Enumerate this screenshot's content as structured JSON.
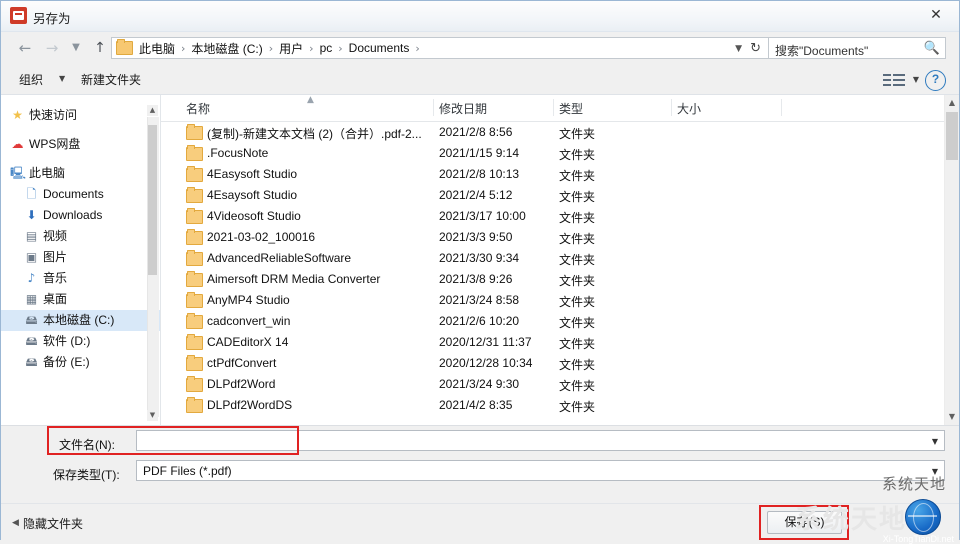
{
  "window": {
    "title": "另存为",
    "close_label": "✕"
  },
  "nav": {
    "back_icon": "←",
    "forward_icon": "→",
    "history_icon": "▼",
    "up_icon": "↑",
    "breadcrumb": [
      "此电脑",
      "本地磁盘 (C:)",
      "用户",
      "pc",
      "Documents"
    ],
    "breadcrumb_sep": "›",
    "dropdown_caret": "▼",
    "refresh_icon": "↻",
    "search_value": "搜索\"Documents\"",
    "search_icon": "🔍"
  },
  "toolbar": {
    "organize": "组织",
    "organize_caret": "▼",
    "new_folder": "新建文件夹",
    "view_caret": "▼",
    "help": "?"
  },
  "sidebar": {
    "items": [
      {
        "label": "快速访问",
        "icon": "★",
        "color": "#f2c14a",
        "selected": false
      },
      {
        "label": "WPS网盘",
        "icon": "☁",
        "color": "#e03a3a",
        "selected": false
      },
      {
        "label": "此电脑",
        "icon": "🖳",
        "color": "#4b88c7",
        "selected": false
      },
      {
        "label": "Documents",
        "icon": "🗋",
        "color": "#4b88c7",
        "selected": false
      },
      {
        "label": "Downloads",
        "icon": "⬇",
        "color": "#2f6fbd",
        "selected": false
      },
      {
        "label": "视频",
        "icon": "▤",
        "color": "#6c7a89",
        "selected": false
      },
      {
        "label": "图片",
        "icon": "▣",
        "color": "#6c7a89",
        "selected": false
      },
      {
        "label": "音乐",
        "icon": "♪",
        "color": "#4b88c7",
        "selected": false
      },
      {
        "label": "桌面",
        "icon": "▦",
        "color": "#6c7a89",
        "selected": false
      },
      {
        "label": "本地磁盘 (C:)",
        "icon": "🖴",
        "color": "#6c7a89",
        "selected": true
      },
      {
        "label": "软件 (D:)",
        "icon": "🖴",
        "color": "#6c7a89",
        "selected": false
      },
      {
        "label": "备份 (E:)",
        "icon": "🖴",
        "color": "#6c7a89",
        "selected": false
      }
    ],
    "scroll_up": "▲",
    "scroll_down": "▼"
  },
  "filelist": {
    "columns": [
      "名称",
      "修改日期",
      "类型",
      "大小"
    ],
    "sort_mark": "▲",
    "rows": [
      {
        "name": "(复制)-新建文本文档 (2)（合并）.pdf-2...",
        "date": "2021/2/8 8:56",
        "type": "文件夹"
      },
      {
        "name": ".FocusNote",
        "date": "2021/1/15 9:14",
        "type": "文件夹"
      },
      {
        "name": "4Easysoft Studio",
        "date": "2021/2/8 10:13",
        "type": "文件夹"
      },
      {
        "name": "4Esaysoft Studio",
        "date": "2021/2/4 5:12",
        "type": "文件夹"
      },
      {
        "name": "4Videosoft Studio",
        "date": "2021/3/17 10:00",
        "type": "文件夹"
      },
      {
        "name": "2021-03-02_100016",
        "date": "2021/3/3 9:50",
        "type": "文件夹"
      },
      {
        "name": "AdvancedReliableSoftware",
        "date": "2021/3/30 9:34",
        "type": "文件夹"
      },
      {
        "name": "Aimersoft DRM Media Converter",
        "date": "2021/3/8 9:26",
        "type": "文件夹"
      },
      {
        "name": "AnyMP4 Studio",
        "date": "2021/3/24 8:58",
        "type": "文件夹"
      },
      {
        "name": "cadconvert_win",
        "date": "2021/2/6 10:20",
        "type": "文件夹"
      },
      {
        "name": "CADEditorX 14",
        "date": "2020/12/31 11:37",
        "type": "文件夹"
      },
      {
        "name": "ctPdfConvert",
        "date": "2020/12/28 10:34",
        "type": "文件夹"
      },
      {
        "name": "DLPdf2Word",
        "date": "2021/3/24 9:30",
        "type": "文件夹"
      },
      {
        "name": "DLPdf2WordDS",
        "date": "2021/4/2 8:35",
        "type": "文件夹"
      }
    ],
    "scroll_up": "▲",
    "scroll_down": "▼"
  },
  "form": {
    "filename_label": "文件名(N):",
    "filename_value": "",
    "filetype_label": "保存类型(T):",
    "filetype_value": "PDF Files (*.pdf)",
    "caret": "▼"
  },
  "footer": {
    "hide_folders": "隐藏文件夹",
    "hide_caret": "◀",
    "save_button": "保存(S)"
  },
  "watermark": {
    "site": "系统天地",
    "ghost": "系统天地",
    "caption": "Xi-TongTianDi.net"
  }
}
